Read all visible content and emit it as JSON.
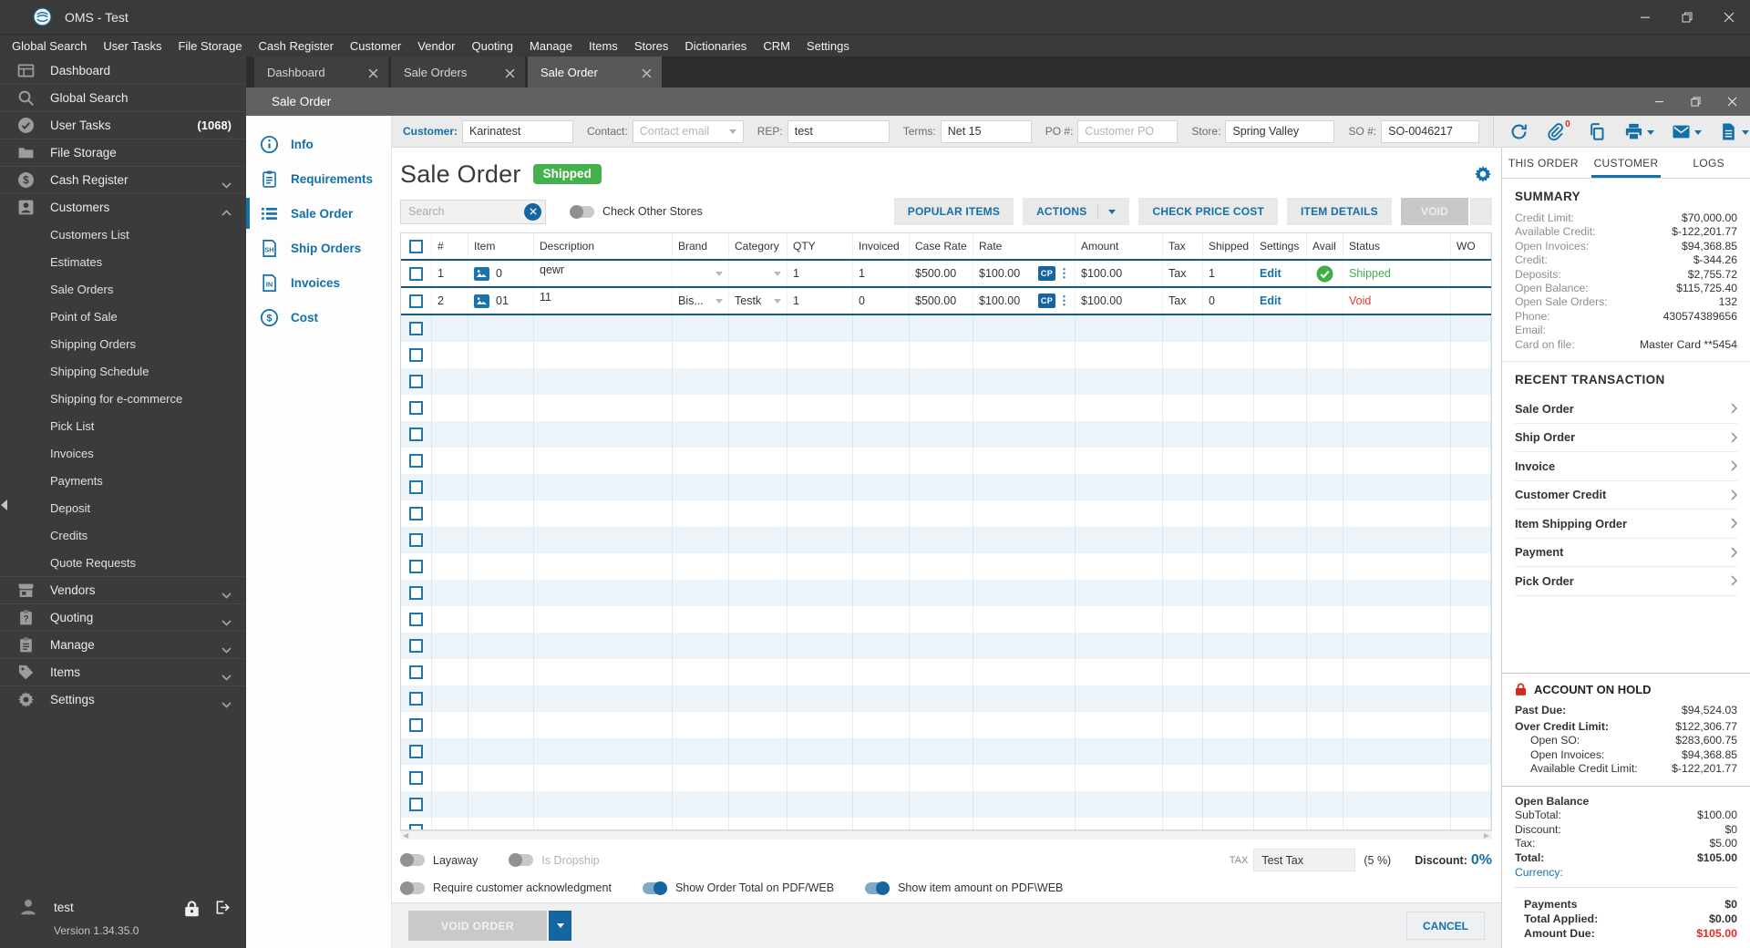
{
  "colors": {
    "accent": "#1470a8",
    "green": "#45b14c",
    "red": "#e02b22",
    "sidebar": "#3b3b3b"
  },
  "titlebar": {
    "title": "OMS - Test"
  },
  "menubar": [
    "Global Search",
    "User Tasks",
    "File Storage",
    "Cash Register",
    "Customer",
    "Vendor",
    "Quoting",
    "Manage",
    "Items",
    "Stores",
    "Dictionaries",
    "CRM",
    "Settings"
  ],
  "sidebar": {
    "items": [
      {
        "label": "Dashboard",
        "icon": "dashboard-icon",
        "type": "top"
      },
      {
        "label": "Global Search",
        "icon": "search-icon",
        "type": "top"
      },
      {
        "label": "User Tasks",
        "icon": "check-circle-icon",
        "type": "top",
        "badge": "(1068)"
      },
      {
        "label": "File Storage",
        "icon": "folder-icon",
        "type": "top"
      },
      {
        "label": "Cash Register",
        "icon": "dollar-circle-icon",
        "type": "top",
        "chevron": "down"
      },
      {
        "label": "Customers",
        "icon": "person-icon",
        "type": "top",
        "chevron": "up"
      },
      {
        "label": "Customers List",
        "type": "sub"
      },
      {
        "label": "Estimates",
        "type": "sub"
      },
      {
        "label": "Sale Orders",
        "type": "sub"
      },
      {
        "label": "Point of Sale",
        "type": "sub"
      },
      {
        "label": "Shipping Orders",
        "type": "sub"
      },
      {
        "label": "Shipping Schedule",
        "type": "sub"
      },
      {
        "label": "Shipping for e-commerce",
        "type": "sub"
      },
      {
        "label": "Pick List",
        "type": "sub"
      },
      {
        "label": "Invoices",
        "type": "sub"
      },
      {
        "label": "Payments",
        "type": "sub"
      },
      {
        "label": "Deposit",
        "type": "sub"
      },
      {
        "label": "Credits",
        "type": "sub"
      },
      {
        "label": "Quote Requests",
        "type": "sub"
      },
      {
        "label": "Vendors",
        "icon": "store-icon",
        "type": "top",
        "chevron": "down"
      },
      {
        "label": "Quoting",
        "icon": "quoting-icon",
        "type": "top",
        "chevron": "down"
      },
      {
        "label": "Manage",
        "icon": "manage-icon",
        "type": "top",
        "chevron": "down"
      },
      {
        "label": "Items",
        "icon": "tag-icon",
        "type": "top",
        "chevron": "down"
      },
      {
        "label": "Settings",
        "icon": "gear-icon",
        "type": "top",
        "chevron": "down"
      }
    ],
    "user": {
      "name": "test"
    },
    "version": "Version 1.34.35.0"
  },
  "tabs": [
    {
      "label": "Dashboard",
      "active": false
    },
    {
      "label": "Sale Orders",
      "active": false
    },
    {
      "label": "Sale Order",
      "active": true
    }
  ],
  "window_title": "Sale Order",
  "fields": [
    {
      "label": "Customer:",
      "value": "Karinatest",
      "accent": true,
      "name": "customer"
    },
    {
      "label": "Contact:",
      "placeholder": "Contact email",
      "dropdown": true,
      "name": "contact"
    },
    {
      "label": "REP:",
      "value": "test",
      "name": "rep"
    },
    {
      "label": "Terms:",
      "value": "Net 15",
      "name": "terms"
    },
    {
      "label": "PO #:",
      "placeholder": "Customer PO",
      "name": "po"
    },
    {
      "label": "Store:",
      "value": "Spring Valley",
      "name": "store"
    },
    {
      "label": "SO #:",
      "value": "SO-0046217",
      "name": "so-number"
    }
  ],
  "toolbar_icons": [
    {
      "name": "sync-icon"
    },
    {
      "name": "attachment-icon",
      "badge": "0"
    },
    {
      "name": "copy-icon"
    },
    {
      "name": "print-icon",
      "dropdown": true
    },
    {
      "name": "email-icon",
      "dropdown": true
    },
    {
      "name": "export-icon",
      "dropdown": true
    }
  ],
  "subnav": [
    {
      "label": "Info",
      "icon": "info-icon"
    },
    {
      "label": "Requirements",
      "icon": "requirements-icon"
    },
    {
      "label": "Sale Order",
      "icon": "sale-order-icon",
      "active": true
    },
    {
      "label": "Ship Orders",
      "icon": "ship-orders-icon"
    },
    {
      "label": "Invoices",
      "icon": "invoices-icon"
    },
    {
      "label": "Cost",
      "icon": "cost-icon"
    }
  ],
  "content": {
    "title": "Sale Order",
    "badge": "Shipped",
    "search_placeholder": "Search",
    "check_other_stores": "Check Other Stores",
    "buttons": {
      "popular": "POPULAR ITEMS",
      "actions": "ACTIONS",
      "check_price": "CHECK PRICE COST",
      "item_details": "ITEM DETAILS",
      "void": "VOID"
    }
  },
  "table": {
    "columns": [
      "#",
      "Item",
      "Description",
      "Brand",
      "Category",
      "QTY",
      "Invoiced",
      "Case Rate",
      "Rate",
      "Amount",
      "Tax",
      "Shipped",
      "Settings",
      "Avail",
      "Status",
      "WO"
    ],
    "cp_badge": "CP",
    "edit_label": "Edit",
    "rows": [
      {
        "num": "1",
        "item": "0",
        "description": "qewr",
        "brand": "",
        "category": "",
        "qty": "1",
        "invoiced": "1",
        "case_rate": "$500.00",
        "rate": "$100.00",
        "amount": "$100.00",
        "tax": "Tax",
        "shipped": "1",
        "avail": true,
        "status": "Shipped",
        "status_color": "green"
      },
      {
        "num": "2",
        "item": "01",
        "description": "11",
        "brand": "Bis...",
        "category": "Testk",
        "qty": "1",
        "invoiced": "0",
        "case_rate": "$500.00",
        "rate": "$100.00",
        "amount": "$100.00",
        "tax": "Tax",
        "shipped": "0",
        "avail": false,
        "status": "Void",
        "status_color": "red"
      }
    ],
    "empty_rows": 20
  },
  "footer": {
    "toggles_row1": [
      {
        "label": "Layaway",
        "on": false,
        "disabled": false,
        "name": "layaway"
      },
      {
        "label": "Is Dropship",
        "on": false,
        "disabled": true,
        "name": "is-dropship"
      }
    ],
    "toggles_row2": [
      {
        "label": "Require customer acknowledgment",
        "on": false,
        "disabled": false,
        "name": "require-ack"
      },
      {
        "label": "Show Order Total on PDF/WEB",
        "on": true,
        "disabled": false,
        "name": "show-order-total"
      },
      {
        "label": "Show item amount on PDF\\WEB",
        "on": true,
        "disabled": false,
        "name": "show-item-amount"
      }
    ],
    "tax_label": "TAX",
    "tax_value": "Test Tax",
    "tax_percent": "(5 %)",
    "discount_label": "Discount:",
    "discount_value": "0%",
    "void_order": "VOID ORDER",
    "cancel": "CANCEL"
  },
  "right_panel": {
    "tabs": [
      "THIS ORDER",
      "CUSTOMER",
      "LOGS"
    ],
    "active_tab": "CUSTOMER",
    "summary": {
      "title": "SUMMARY",
      "rows": [
        [
          "Credit Limit:",
          "$70,000.00"
        ],
        [
          "Available Credit:",
          "$-122,201.77"
        ],
        [
          "Open Invoices:",
          "$94,368.85"
        ],
        [
          "Credit:",
          "$-344.26"
        ],
        [
          "Deposits:",
          "$2,755.72"
        ],
        [
          "Open Balance:",
          "$115,725.40"
        ],
        [
          "Open Sale Orders:",
          "132"
        ],
        [
          "Phone:",
          "430574389656"
        ],
        [
          "Email:",
          ""
        ],
        [
          "Card on file:",
          "Master Card **5454"
        ]
      ]
    },
    "recent": {
      "title": "RECENT TRANSACTION",
      "items": [
        "Sale Order",
        "Ship Order",
        "Invoice",
        "Customer Credit",
        "Item Shipping Order",
        "Payment",
        "Pick Order"
      ]
    },
    "account_on_hold": {
      "title": "ACCOUNT ON HOLD",
      "rows": [
        {
          "label": "Past Due:",
          "value": "$94,524.03",
          "bold": true,
          "indent": false
        },
        {
          "label": "Over Credit Limit:",
          "value": "$122,306.77",
          "bold": true,
          "indent": false
        },
        {
          "label": "Open SO:",
          "value": "$283,600.75",
          "bold": false,
          "indent": true
        },
        {
          "label": "Open Invoices:",
          "value": "$94,368.85",
          "bold": false,
          "indent": true
        },
        {
          "label": "Available Credit Limit:",
          "value": "$-122,201.77",
          "bold": false,
          "indent": true
        }
      ]
    },
    "totals": {
      "title": "Open Balance",
      "rows": [
        {
          "label": "SubTotal:",
          "value": "$100.00",
          "bold": false
        },
        {
          "label": "Discount:",
          "value": "$0",
          "bold": false
        },
        {
          "label": "Tax:",
          "value": "$5.00",
          "bold": false
        },
        {
          "label": "Total:",
          "value": "$105.00",
          "bold": true
        }
      ],
      "currency_label": "Currency:",
      "payments": [
        {
          "label": "Payments",
          "value": "$0",
          "red": false
        },
        {
          "label": "Total Applied:",
          "value": "$0.00",
          "red": false
        },
        {
          "label": "Amount Due:",
          "value": "$105.00",
          "red": true
        }
      ]
    }
  }
}
